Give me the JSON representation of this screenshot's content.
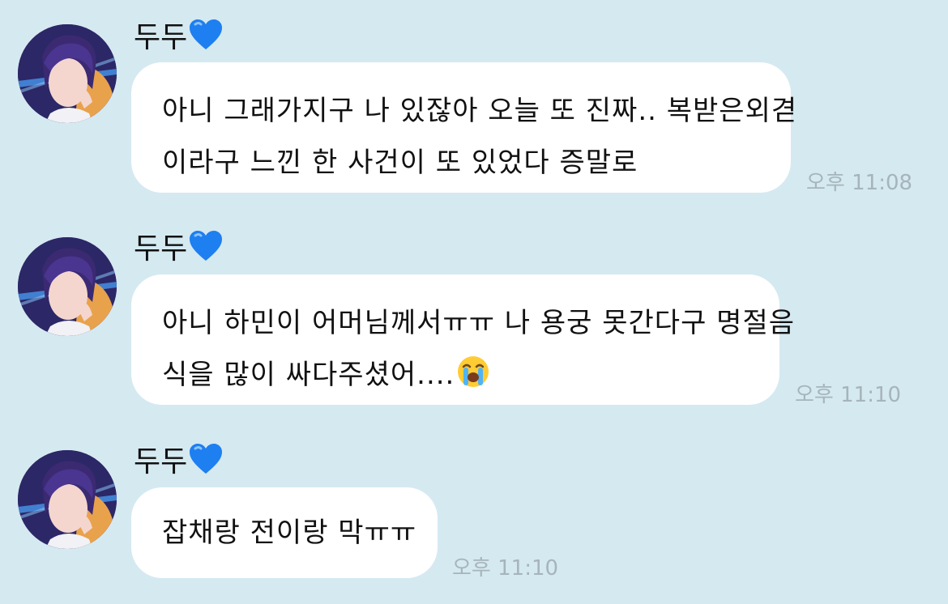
{
  "messages": [
    {
      "sender": "두두",
      "lines": [
        "아니 그래가지구 나 있잖아 오늘 또 진짜.. 복받은외겯",
        "이라구 느낀 한 사건이 또 있었다 증말로"
      ],
      "time": "오후 11:08",
      "emoji": ""
    },
    {
      "sender": "두두",
      "lines": [
        "아니 하민이 어머님께서ㅠㅠ 나 용궁 못간다구 명절음",
        "식을 많이 싸다주셨어...."
      ],
      "time": "오후 11:10",
      "emoji": "loudly-crying-face-emoji"
    },
    {
      "sender": "두두",
      "lines": [
        "잡채랑 전이랑 막ㅠㅠ"
      ],
      "time": "오후 11:10",
      "emoji": ""
    }
  ],
  "colors": {
    "background": "#d5e9f1",
    "bubble": "#ffffff",
    "time": "#a7b4bb",
    "heart": "#1e7ff0"
  },
  "icons": {
    "sender_badge": "blue-heart-icon",
    "avatar": "profile-avatar"
  }
}
